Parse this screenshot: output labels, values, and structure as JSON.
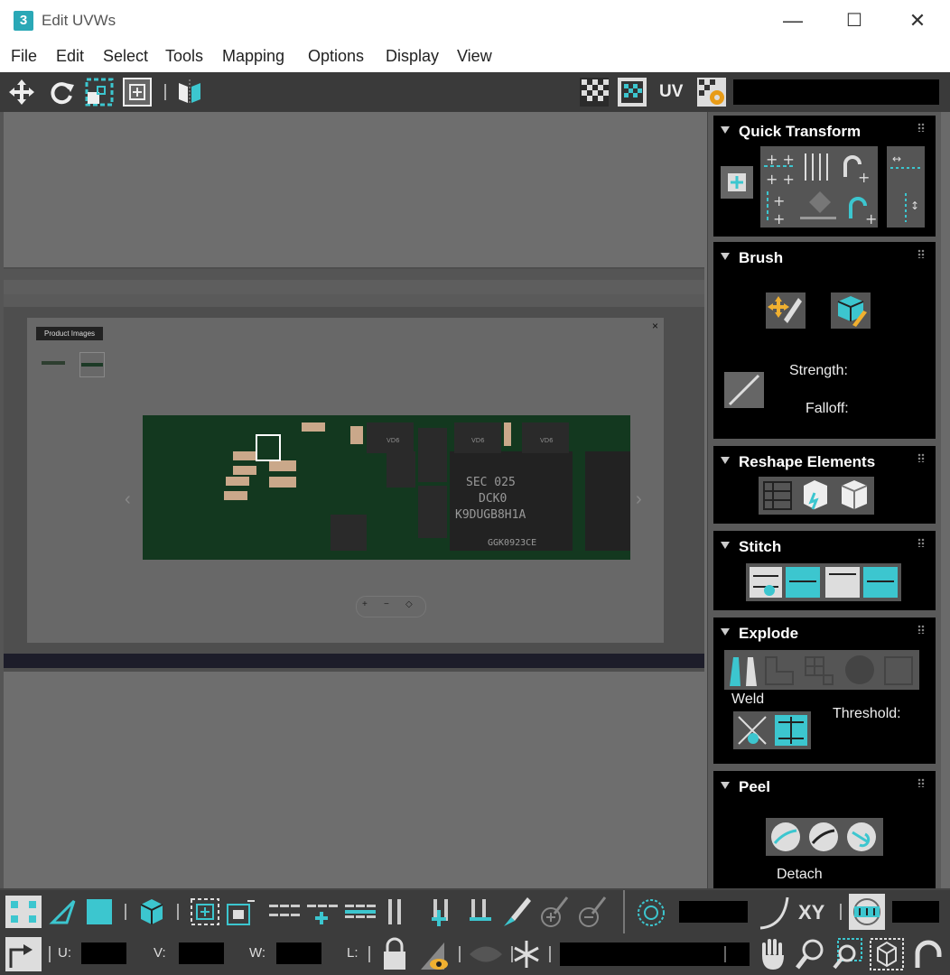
{
  "window": {
    "title": "Edit UVWs",
    "app_icon": "3",
    "minimize": "—",
    "maximize": "☐",
    "close": "✕"
  },
  "menu": [
    "File",
    "Edit",
    "Select",
    "Tools",
    "Mapping",
    "Options",
    "Display",
    "View"
  ],
  "toolbar": {
    "uv_label": "UV"
  },
  "viewport": {
    "embedded_screenshot": {
      "modal_label": "Product Images",
      "modal_close": "×",
      "chip_text_1": "SEC 025",
      "chip_text_2": "DCK0",
      "chip_text_3": "K9DUGB8H1A",
      "chip_text_4": "GGK0923CE",
      "part_label": "VD6"
    }
  },
  "panel": {
    "quick_transform": {
      "title": "Quick Transform"
    },
    "brush": {
      "title": "Brush",
      "strength_label": "Strength:",
      "falloff_label": "Falloff:"
    },
    "reshape": {
      "title": "Reshape Elements"
    },
    "stitch": {
      "title": "Stitch"
    },
    "explode": {
      "title": "Explode",
      "weld_label": "Weld",
      "threshold_label": "Threshold:"
    },
    "peel": {
      "title": "Peel",
      "detach_label": "Detach"
    }
  },
  "bottom": {
    "xy_label": "XY",
    "u_label": "U:",
    "v_label": "V:",
    "w_label": "W:",
    "l_label": "L:"
  },
  "colors": {
    "accent": "#3cc6cf",
    "panel_bg": "#000000",
    "viewport_bg": "#6e6e6e",
    "pcb_green": "#13381f"
  }
}
